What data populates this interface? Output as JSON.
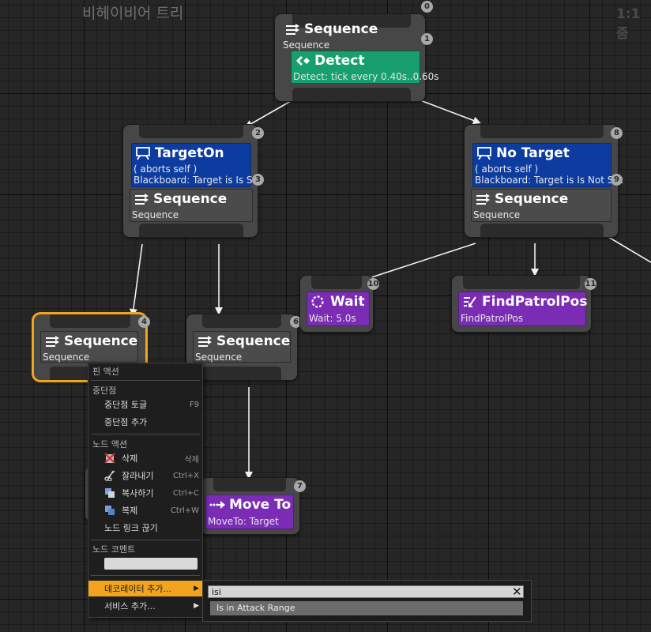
{
  "window": {
    "title": "비헤이비어 트리",
    "zoom": "1:1 줌"
  },
  "nodes": {
    "root_seq": {
      "title": "Sequence",
      "subtitle": "Sequence",
      "index": "1",
      "root_index": "0"
    },
    "detect": {
      "title": "Detect",
      "subtitle": "Detect: tick every 0.40s..0.60s"
    },
    "targeton": {
      "title": "TargetOn",
      "line1": "( aborts self )",
      "line2": "Blackboard: Target is Is Set",
      "index": "2",
      "dec_index": "3"
    },
    "targeton_seq": {
      "title": "Sequence",
      "subtitle": "Sequence"
    },
    "notarget": {
      "title": "No Target",
      "line1": "( aborts self )",
      "line2": "Blackboard: Target is Is Not Set",
      "index": "8",
      "dec_index": "9"
    },
    "notarget_seq": {
      "title": "Sequence",
      "subtitle": "Sequence"
    },
    "seq4": {
      "title": "Sequence",
      "subtitle": "Sequence",
      "index": "4"
    },
    "seq6": {
      "title": "Sequence",
      "subtitle": "Sequence",
      "index": "6"
    },
    "wait": {
      "title": "Wait",
      "subtitle": "Wait: 5.0s",
      "index": "10"
    },
    "findpatrol": {
      "title": "FindPatrolPos",
      "subtitle": "FindPatrolPos",
      "index": "11"
    },
    "moveto": {
      "title": "Move To",
      "subtitle": "MoveTo: Target",
      "index": "7"
    }
  },
  "context_menu": {
    "pin_actions": "핀 액션",
    "breakpoint_header": "중단점",
    "toggle_breakpoint": "중단점 토글",
    "toggle_breakpoint_key": "F9",
    "add_breakpoint": "중단점 추가",
    "node_actions_header": "노드 액션",
    "delete": "삭제",
    "delete_key": "삭제",
    "cut": "잘라내기",
    "cut_key": "Ctrl+X",
    "copy": "복사하기",
    "copy_key": "Ctrl+C",
    "duplicate": "복제",
    "duplicate_key": "Ctrl+W",
    "break_links": "노드 링크 끊기",
    "node_comment_header": "노드 코멘트",
    "add_decorator": "데코레이터 추가...",
    "add_service": "서비스 추가..."
  },
  "submenu": {
    "search_value": "isi",
    "result": "Is in Attack Range"
  },
  "colors": {
    "selection": "#f2a41c",
    "composite": "#4b4b4b",
    "service": "#17a06e",
    "decorator": "#0d3ca1",
    "task": "#7a2cb5"
  }
}
